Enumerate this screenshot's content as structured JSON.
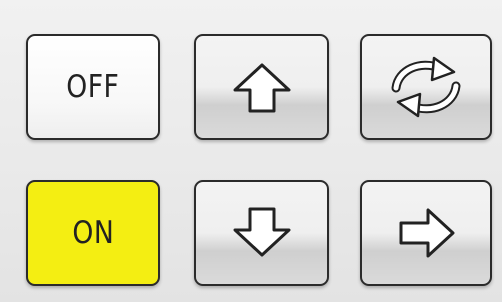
{
  "keypad": {
    "off_label": "OFF",
    "on_label": "ON",
    "up_icon": "arrow-up-icon",
    "down_icon": "arrow-down-icon",
    "right_icon": "arrow-right-icon",
    "cycle_icon": "refresh-cycle-icon"
  },
  "colors": {
    "on_key": "#f4ee12",
    "key_border": "#2b2b2b",
    "panel_background": "#ebebeb"
  }
}
